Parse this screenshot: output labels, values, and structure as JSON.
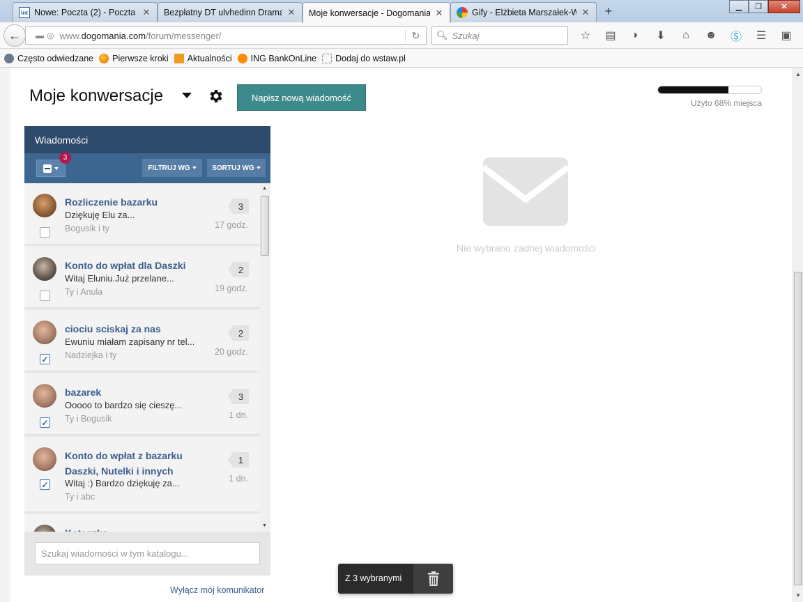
{
  "browser": {
    "tabs": [
      {
        "title": "Nowe: Poczta (2) - Poczta ...",
        "icon": "int-icon",
        "active": false
      },
      {
        "title": "Bezpłatny DT ulvhedinn Drama...",
        "icon": "none",
        "active": false
      },
      {
        "title": "Moje konwersacje - Dogomania",
        "icon": "none",
        "active": true
      },
      {
        "title": "Gify - Elżbieta Marszałek-W...",
        "icon": "picasa-icon",
        "active": false
      }
    ],
    "new_tab": "+",
    "url_prefix": "www.",
    "url_domain": "dogomania.com",
    "url_path": "/forum/messenger/",
    "search_placeholder": "Szukaj",
    "bookmarks": [
      {
        "label": "Często odwiedzane",
        "icon": "gear"
      },
      {
        "label": "Pierwsze kroki",
        "icon": "ff"
      },
      {
        "label": "Aktualności",
        "icon": "rss"
      },
      {
        "label": "ING BankOnLine",
        "icon": "ing"
      },
      {
        "label": "Dodaj do wstaw.pl",
        "icon": "dash"
      }
    ]
  },
  "header": {
    "title": "Moje konwersacje",
    "new_message_button": "Napisz nową wiadomość",
    "quota_fraction": 0.68,
    "quota_text": "Użyto 68% miejsca"
  },
  "panel": {
    "title": "Wiadomości",
    "selected_badge": "3",
    "filter_label": "FILTRUJ WG",
    "sort_label": "SORTUJ WG",
    "search_placeholder": "Szukaj wiadomości w tym katalogu...",
    "turn_off_link": "Wyłącz mój komunikator"
  },
  "conversations": [
    {
      "title": "Rozliczenie bazarku",
      "snippet": "Dziękuję Elu za...",
      "participants": "Bogusik i ty",
      "count": "3",
      "time": "17 godz.",
      "checked": false
    },
    {
      "title": "Konto do wpłat dla Daszki",
      "snippet": "Witaj Eluniu.Już przelane...",
      "participants": "Ty i Anula",
      "count": "2",
      "time": "19 godz.",
      "checked": false
    },
    {
      "title": "ciociu sciskaj za nas",
      "snippet": "Ewuniu miałam zapisany nr tel...",
      "participants": "Nadziejka i ty",
      "count": "2",
      "time": "20 godz.",
      "checked": true
    },
    {
      "title": "bazarek",
      "snippet": "Ooooo to bardzo się cieszę...",
      "participants": "Ty i Bogusik",
      "count": "3",
      "time": "1 dn.",
      "checked": true
    },
    {
      "title": "Konto do wpłat z bazarku Daszki, Nutelki i innych",
      "snippet": "Witaj :) Bardzo dziękuję za...",
      "participants": "Ty i abc",
      "count": "1",
      "time": "1 dn.",
      "checked": true
    },
    {
      "title": "Koteczka",
      "snippet": "",
      "participants": "",
      "count": "",
      "time": "",
      "checked": false
    }
  ],
  "empty_state": {
    "text": "Nie wybrano żadnej wiadomości"
  },
  "bulk": {
    "label": "Z 3 wybranymi"
  }
}
